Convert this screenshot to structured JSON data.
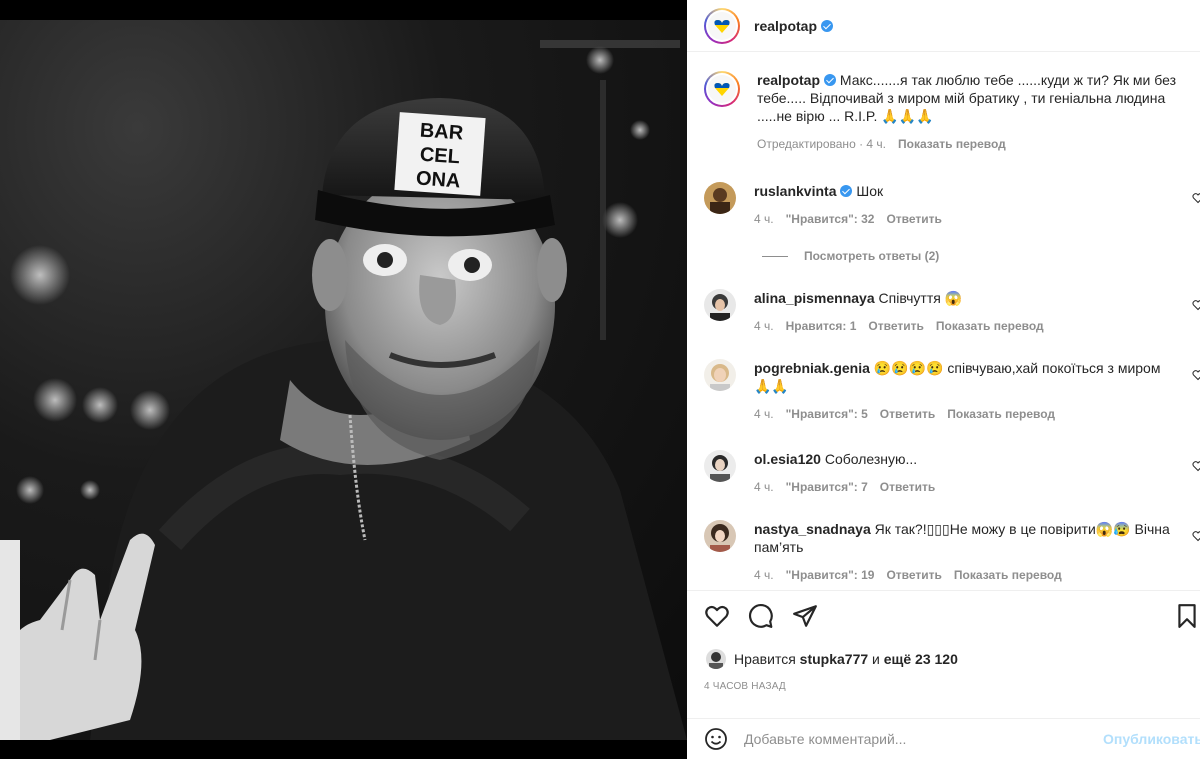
{
  "post": {
    "author": "realpotap",
    "caption": "Макс.......я так люблю тебе ......куди ж ти? Як ми без тебе..... Відпочивай з миром мій братику , ти геніальна людина .....не вірю ... R.I.P. 🙏🙏🙏",
    "edited_label": "Отредактировано · 4 ч.",
    "translate_label": "Показать перевод",
    "cap_text": "BARCELONA"
  },
  "comments": [
    {
      "user": "ruslankvinta",
      "verified": true,
      "text": "Шок",
      "time": "4 ч.",
      "likes": "\"Нравится\": 32",
      "reply": "Ответить",
      "translate": "",
      "view_replies": "Посмотреть ответы (2)"
    },
    {
      "user": "alina_pismennaya",
      "text": "Співчуття 😱",
      "time": "4 ч.",
      "likes": "Нравится: 1",
      "reply": "Ответить",
      "translate": "Показать перевод"
    },
    {
      "user": "pogrebniak.genia",
      "text": "😢😢😢😢 співчуваю,хай покоїться з миром 🙏🙏",
      "time": "4 ч.",
      "likes": "\"Нравится\": 5",
      "reply": "Ответить",
      "translate": "Показать перевод"
    },
    {
      "user": "ol.esia120",
      "text": "Соболезную...",
      "time": "4 ч.",
      "likes": "\"Нравится\": 7",
      "reply": "Ответить",
      "translate": ""
    },
    {
      "user": "nastya_snadnaya",
      "text": "Як так?!▯▯▯Не можу в це повірити😱😰 Вічна пам’ять",
      "time": "4 ч.",
      "likes": "\"Нравится\": 19",
      "reply": "Ответить",
      "translate": "Показать перевод"
    }
  ],
  "likes_line": {
    "prefix": "Нравится",
    "user": "stupka777",
    "middle": "и",
    "rest": "ещё 23 120"
  },
  "timestamp": "4 ЧАСОВ НАЗАД",
  "add_comment": {
    "placeholder": "Добавьте комментарий...",
    "publish": "Опубликовать"
  }
}
